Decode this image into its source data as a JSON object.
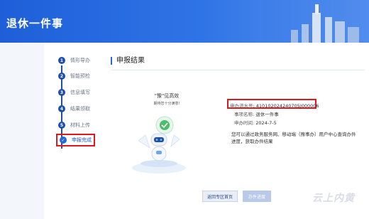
{
  "header": {
    "title": "退休一件事"
  },
  "steps": [
    {
      "num": "1",
      "label": "情形导办"
    },
    {
      "num": "2",
      "label": "智能预检"
    },
    {
      "num": "3",
      "label": "信息填写"
    },
    {
      "num": "4",
      "label": "结果领取"
    },
    {
      "num": "5",
      "label": "材料上传"
    },
    {
      "num": "✓",
      "label": "申报完成"
    }
  ],
  "main": {
    "title": "申报结果",
    "slogan": "\"豫\"见高效",
    "slogan_sub": "期待您十分满意!",
    "fields": [
      {
        "label": "申办流水号:",
        "value": "410102024240705J000006"
      },
      {
        "label": "事项名称:",
        "value": "退休一件事"
      },
      {
        "label": "申办时间:",
        "value": "2024-7-5"
      }
    ],
    "note": "您可以通过政务服务网、移动端（豫事办）用户中心查询办件进度，获取办件结果",
    "back_button": "返回专区首页",
    "progress_button": "办件进度"
  },
  "watermark": "云上内黄"
}
